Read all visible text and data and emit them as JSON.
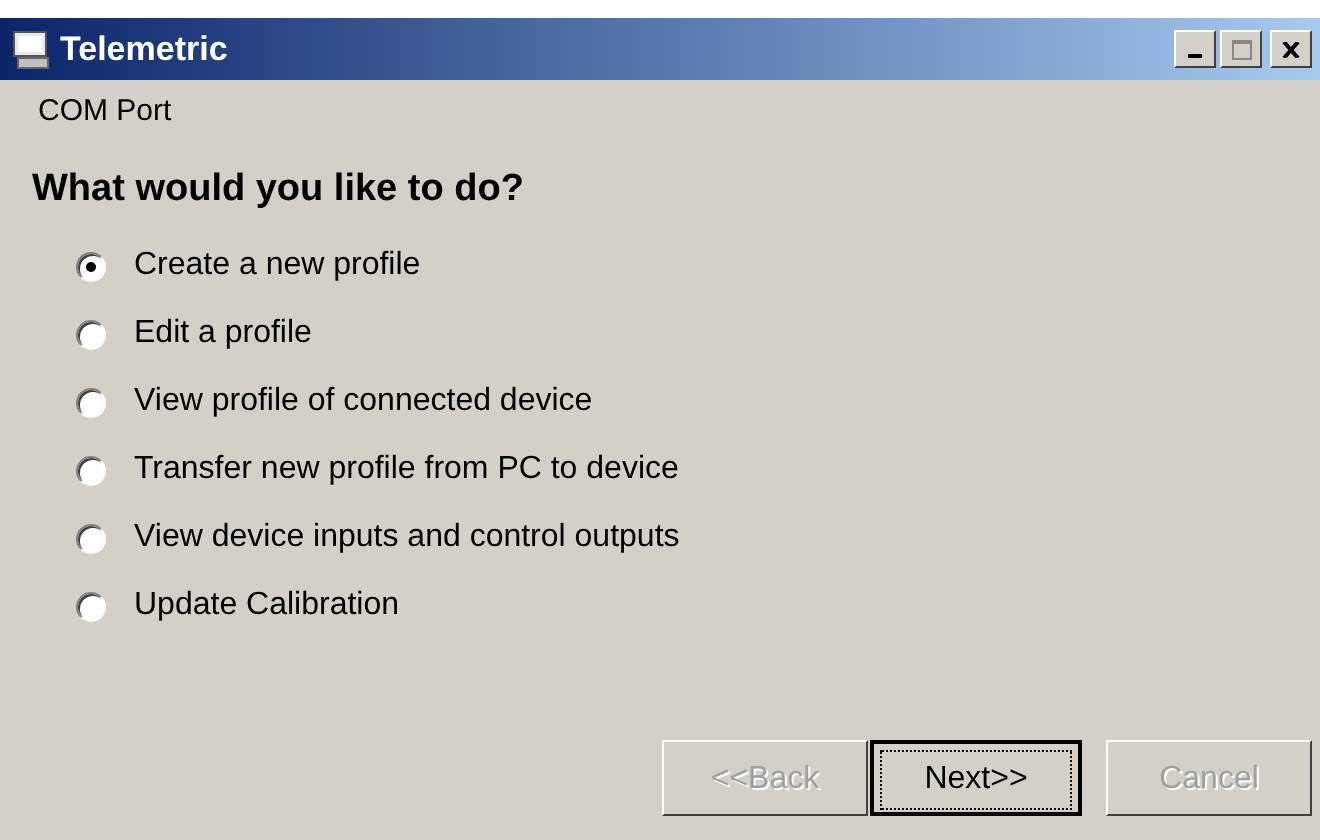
{
  "window": {
    "title": "Telemetric"
  },
  "subtitle": "COM Port",
  "heading": "What would you like to do?",
  "options": [
    {
      "label": "Create a new profile",
      "selected": true
    },
    {
      "label": "Edit a profile",
      "selected": false
    },
    {
      "label": "View profile of connected device",
      "selected": false
    },
    {
      "label": "Transfer new profile from PC to device",
      "selected": false
    },
    {
      "label": "View device inputs and control outputs",
      "selected": false
    },
    {
      "label": "Update Calibration",
      "selected": false
    }
  ],
  "buttons": [
    {
      "label": "<<Back",
      "disabled": true,
      "focused": false
    },
    {
      "label": "Next>>",
      "disabled": false,
      "focused": true
    },
    {
      "label": "Cancel",
      "disabled": true,
      "focused": false
    }
  ]
}
